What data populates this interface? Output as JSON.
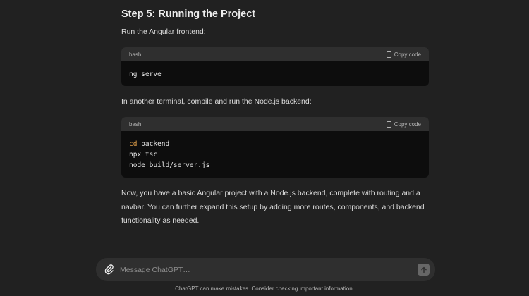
{
  "message": {
    "heading": "Step 5: Running the Project",
    "para1": "Run the Angular frontend:",
    "code1": {
      "lang": "bash",
      "copy_label": "Copy code",
      "lines": [
        "ng serve"
      ]
    },
    "para2": "In another terminal, compile and run the Node.js backend:",
    "code2": {
      "lang": "bash",
      "copy_label": "Copy code",
      "line1_keyword": "cd",
      "line1_rest": " backend",
      "line2": "npx tsc",
      "line3": "node build/server.js"
    },
    "para3_line1": "Now, you have a basic Angular project with a Node.js backend, complete with routing and a",
    "para3_line2": "navbar. You can further expand this setup by adding more routes, components, and backend",
    "para3_line3": "functionality as needed."
  },
  "composer": {
    "placeholder": "Message ChatGPT…",
    "attach_icon": "paperclip-icon",
    "send_icon": "arrow-up-icon"
  },
  "footer": {
    "disclaimer": "ChatGPT can make mistakes. Consider checking important information."
  },
  "colors": {
    "background": "#212121",
    "code_bg": "#0d0d0d",
    "code_header": "#2f2f2f",
    "keyword": "#e5a24a"
  }
}
